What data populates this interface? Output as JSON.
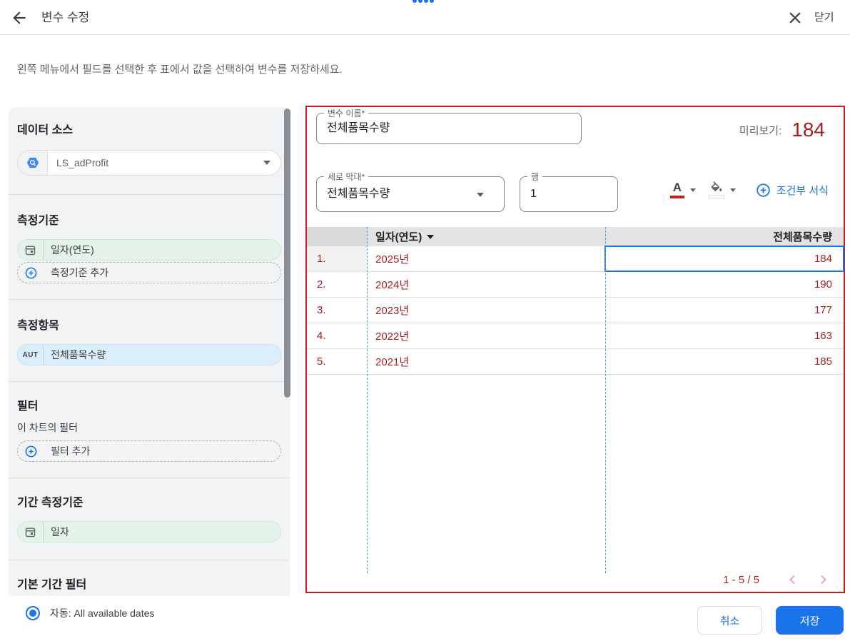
{
  "header": {
    "title": "변수 수정",
    "close_label": "닫기"
  },
  "instruction": "왼쪽 메뉴에서 필드를 선택한 후 표에서 값을 선택하여 변수를 저장하세요.",
  "icons": {
    "back": "arrow-left-icon",
    "close": "close-icon",
    "data_source": "bigquery-hexagon-icon",
    "calendar": "calendar-icon",
    "add": "plus-circle-icon",
    "text_color": "text-color-icon",
    "fill_color": "fill-color-icon",
    "sort": "sort-desc-icon",
    "prev": "chevron-left-icon",
    "next": "chevron-right-icon"
  },
  "sidebar": {
    "data_source": {
      "title": "데이터 소스",
      "value": "LS_adProfit"
    },
    "dimension": {
      "title": "측정기준",
      "field": "일자(연도)",
      "add_label": "측정기준 추가"
    },
    "metric": {
      "title": "측정항목",
      "badge": "AUT",
      "field": "전체품목수량"
    },
    "filter": {
      "title": "필터",
      "subtitle": "이 차트의 필터",
      "add_label": "필터 추가"
    },
    "date_dimension": {
      "title": "기간 측정기준",
      "field": "일자"
    },
    "default_date_filter": {
      "title": "기본 기간 필터",
      "radio_label": "자동: All available dates"
    }
  },
  "panel": {
    "variable_name": {
      "label": "변수 이름*",
      "value": "전체품목수량"
    },
    "preview": {
      "label": "미리보기:",
      "value": "184"
    },
    "bar_select": {
      "label": "세로 막대*",
      "value": "전체품목수량"
    },
    "row_input": {
      "label": "행",
      "value": "1"
    },
    "conditional_format_label": "조건부 서식",
    "table": {
      "columns": [
        "일자(연도)",
        "전체품목수량"
      ],
      "rows": [
        {
          "index": "1.",
          "dimension": "2025년",
          "value": "184"
        },
        {
          "index": "2.",
          "dimension": "2024년",
          "value": "190"
        },
        {
          "index": "3.",
          "dimension": "2023년",
          "value": "177"
        },
        {
          "index": "4.",
          "dimension": "2022년",
          "value": "163"
        },
        {
          "index": "5.",
          "dimension": "2021년",
          "value": "185"
        }
      ],
      "selected_cell": {
        "row": 0,
        "column": "전체품목수량"
      }
    },
    "pagination": {
      "label": "1 - 5 / 5"
    }
  },
  "footer": {
    "cancel_label": "취소",
    "save_label": "저장"
  },
  "colors": {
    "accent": "#1a73e8",
    "red_text": "#a91e23",
    "panel_border": "#b3261e",
    "sidebar_bg": "#f1f3f4",
    "table_header_bg": "#e3e3e3",
    "dashed_line": "#5b9bd5",
    "dimension_chip": "#e4f3e9",
    "metric_chip": "#daeefb"
  }
}
